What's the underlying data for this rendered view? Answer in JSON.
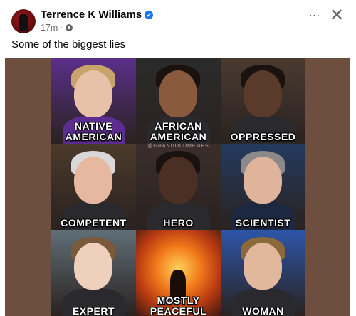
{
  "post": {
    "author": "Terrence K Williams",
    "time": "17m",
    "caption": "Some of the biggest lies",
    "more_icon": "⋯",
    "close_icon": "✕"
  },
  "meme": {
    "watermark": "@GRANDOLDMEMES",
    "tiles": [
      {
        "lines": [
          "NATIVE",
          "AMERICAN"
        ],
        "accent": "#5a2f8a"
      },
      {
        "lines": [
          "AFRICAN",
          "AMERICAN"
        ],
        "accent": "#2b2b2b"
      },
      {
        "lines": [
          "OPPRESSED"
        ],
        "accent": "#4a3b31"
      },
      {
        "lines": [
          "COMPETENT"
        ],
        "accent": "#4a3a2a"
      },
      {
        "lines": [
          "HERO"
        ],
        "accent": "#3a2e2a"
      },
      {
        "lines": [
          "SCIENTIST"
        ],
        "accent": "#233a5e"
      },
      {
        "lines": [
          "EXPERT"
        ],
        "accent": "#5f6f77"
      },
      {
        "lines": [
          "MOSTLY",
          "PEACEFUL"
        ],
        "accent": "#d9571b"
      },
      {
        "lines": [
          "WOMAN"
        ],
        "accent": "#2c55a8"
      }
    ]
  }
}
